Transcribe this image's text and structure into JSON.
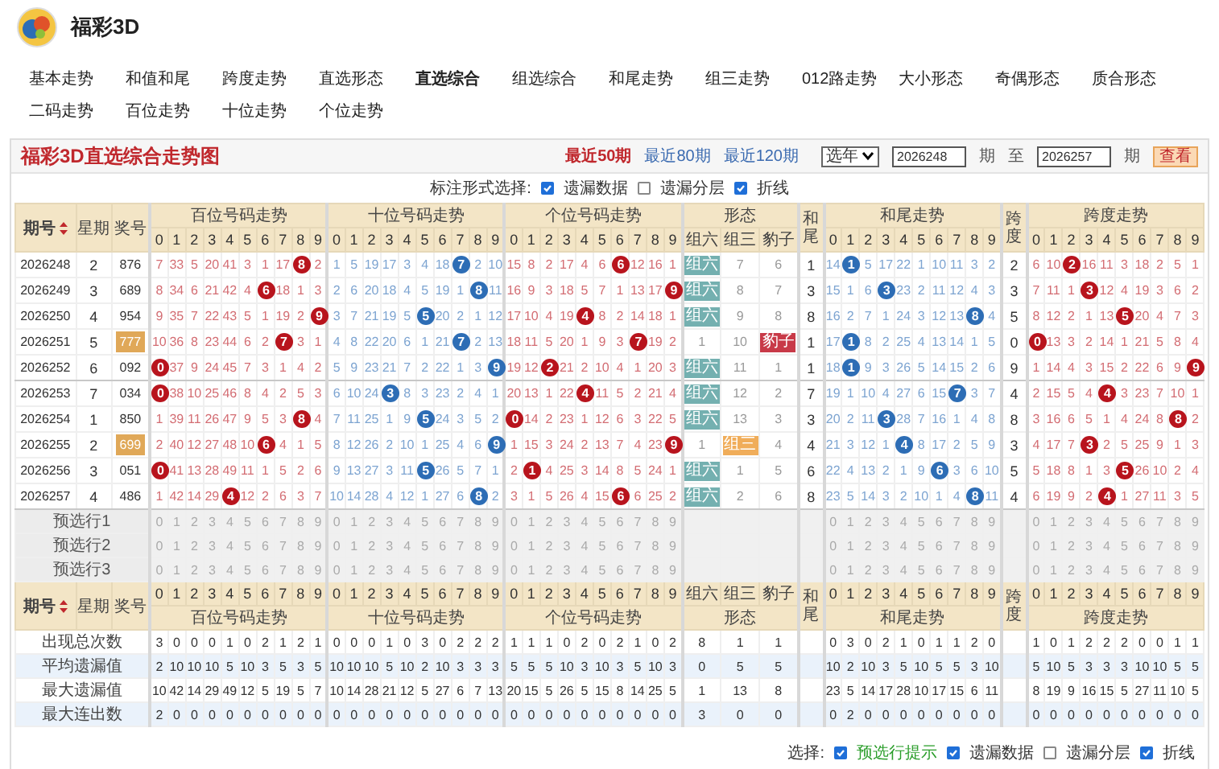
{
  "app": {
    "title": "福彩3D"
  },
  "nav": [
    {
      "label": "基本走势",
      "selected": false
    },
    {
      "label": "和值和尾",
      "selected": false
    },
    {
      "label": "跨度走势",
      "selected": false
    },
    {
      "label": "直选形态",
      "selected": false
    },
    {
      "label": "直选综合",
      "selected": true
    },
    {
      "label": "组选综合",
      "selected": false
    },
    {
      "label": "和尾走势",
      "selected": false
    },
    {
      "label": "组三走势",
      "selected": false
    },
    {
      "label": "012路走势",
      "selected": false
    },
    {
      "label": "大小形态",
      "selected": false
    },
    {
      "label": "奇偶形态",
      "selected": false
    },
    {
      "label": "质合形态",
      "selected": false
    },
    {
      "label": "二码走势",
      "selected": false
    },
    {
      "label": "百位走势",
      "selected": false
    },
    {
      "label": "十位走势",
      "selected": false
    },
    {
      "label": "个位走势",
      "selected": false
    }
  ],
  "panel": {
    "title": "福彩3D直选综合走势图",
    "range_links": [
      {
        "label": "最近50期",
        "selected": true
      },
      {
        "label": "最近80期",
        "selected": false
      },
      {
        "label": "最近120期",
        "selected": false
      }
    ],
    "year_select": "选年",
    "from": "2026248",
    "from_unit": "期",
    "to_label": "至",
    "to": "2026257",
    "to_unit": "期",
    "query_button": "查看"
  },
  "mark_options": {
    "label": "标注形式选择:",
    "options": [
      {
        "label": "遗漏数据",
        "checked": true
      },
      {
        "label": "遗漏分层",
        "checked": false
      },
      {
        "label": "折线",
        "checked": true
      }
    ]
  },
  "table": {
    "head": {
      "period": "期号",
      "weekday": "星期",
      "number": "奖号"
    },
    "sections": [
      {
        "kind": "digits",
        "title": "百位号码走势",
        "color": "#b8141d",
        "digits": [
          "0",
          "1",
          "2",
          "3",
          "4",
          "5",
          "6",
          "7",
          "8",
          "9"
        ]
      },
      {
        "kind": "digits",
        "title": "十位号码走势",
        "color": "#2d6db5",
        "digits": [
          "0",
          "1",
          "2",
          "3",
          "4",
          "5",
          "6",
          "7",
          "8",
          "9"
        ]
      },
      {
        "kind": "digits",
        "title": "个位号码走势",
        "color": "#b8141d",
        "digits": [
          "0",
          "1",
          "2",
          "3",
          "4",
          "5",
          "6",
          "7",
          "8",
          "9"
        ]
      },
      {
        "kind": "shape",
        "title": "形态",
        "columns": [
          {
            "label": "组六",
            "color": "#74b0b0"
          },
          {
            "label": "组三",
            "color": "#f0ad5a"
          },
          {
            "label": "豹子",
            "color": "#c83a48"
          }
        ]
      },
      {
        "kind": "single",
        "title": "和尾"
      },
      {
        "kind": "digits",
        "title": "和尾走势",
        "color": "#2d6db5",
        "digits": [
          "0",
          "1",
          "2",
          "3",
          "4",
          "5",
          "6",
          "7",
          "8",
          "9"
        ]
      },
      {
        "kind": "single",
        "title": "跨度"
      },
      {
        "kind": "digits",
        "title": "跨度走势",
        "color": "#b8141d",
        "digits": [
          "0",
          "1",
          "2",
          "3",
          "4",
          "5",
          "6",
          "7",
          "8",
          "9"
        ]
      }
    ],
    "rows": [
      {
        "period": "2026248",
        "weekday": "2",
        "number": "876",
        "highlighted": false,
        "cells": [
          [
            "7",
            "33",
            "5",
            "20",
            "41",
            "3",
            "1",
            "17",
            {
              "text": "8",
              "hit": true
            },
            "2"
          ],
          [
            "1",
            "5",
            "19",
            "17",
            "3",
            "4",
            "18",
            {
              "text": "7",
              "hit": true
            },
            "2",
            "10"
          ],
          [
            "15",
            "8",
            "2",
            "17",
            "4",
            "6",
            {
              "text": "6",
              "hit": true
            },
            "12",
            "16",
            "1"
          ],
          [
            {
              "text": "组六",
              "hit": true
            },
            "7",
            "6"
          ],
          [
            "1"
          ],
          [
            "14",
            {
              "text": "1",
              "hit": true
            },
            "5",
            "17",
            "22",
            "1",
            "10",
            "11",
            "3",
            "2"
          ],
          [
            "2"
          ],
          [
            "6",
            "10",
            {
              "text": "2",
              "hit": true
            },
            "16",
            "11",
            "3",
            "18",
            "2",
            "5",
            "1"
          ]
        ]
      },
      {
        "period": "2026249",
        "weekday": "3",
        "number": "689",
        "highlighted": false,
        "cells": [
          [
            "8",
            "34",
            "6",
            "21",
            "42",
            "4",
            {
              "text": "6",
              "hit": true
            },
            "18",
            "1",
            "3"
          ],
          [
            "2",
            "6",
            "20",
            "18",
            "4",
            "5",
            "19",
            "1",
            {
              "text": "8",
              "hit": true
            },
            "11"
          ],
          [
            "16",
            "9",
            "3",
            "18",
            "5",
            "7",
            "1",
            "13",
            "17",
            {
              "text": "9",
              "hit": true
            }
          ],
          [
            {
              "text": "组六",
              "hit": true
            },
            "8",
            "7"
          ],
          [
            "3"
          ],
          [
            "15",
            "1",
            "6",
            {
              "text": "3",
              "hit": true
            },
            "23",
            "2",
            "11",
            "12",
            "4",
            "3"
          ],
          [
            "3"
          ],
          [
            "7",
            "11",
            "1",
            {
              "text": "3",
              "hit": true
            },
            "12",
            "4",
            "19",
            "3",
            "6",
            "2"
          ]
        ]
      },
      {
        "period": "2026250",
        "weekday": "4",
        "number": "954",
        "highlighted": false,
        "cells": [
          [
            "9",
            "35",
            "7",
            "22",
            "43",
            "5",
            "1",
            "19",
            "2",
            {
              "text": "9",
              "hit": true
            }
          ],
          [
            "3",
            "7",
            "21",
            "19",
            "5",
            {
              "text": "5",
              "hit": true
            },
            "20",
            "2",
            "1",
            "12"
          ],
          [
            "17",
            "10",
            "4",
            "19",
            {
              "text": "4",
              "hit": true
            },
            "8",
            "2",
            "14",
            "18",
            "1"
          ],
          [
            {
              "text": "组六",
              "hit": true
            },
            "9",
            "8"
          ],
          [
            "8"
          ],
          [
            "16",
            "2",
            "7",
            "1",
            "24",
            "3",
            "12",
            "13",
            {
              "text": "8",
              "hit": true
            },
            "4"
          ],
          [
            "5"
          ],
          [
            "8",
            "12",
            "2",
            "1",
            "13",
            {
              "text": "5",
              "hit": true
            },
            "20",
            "4",
            "7",
            "3"
          ]
        ]
      },
      {
        "period": "2026251",
        "weekday": "5",
        "number": "777",
        "highlighted": true,
        "cells": [
          [
            "10",
            "36",
            "8",
            "23",
            "44",
            "6",
            "2",
            {
              "text": "7",
              "hit": true
            },
            "3",
            "1"
          ],
          [
            "4",
            "8",
            "22",
            "20",
            "6",
            "1",
            "21",
            {
              "text": "7",
              "hit": true
            },
            "2",
            "13"
          ],
          [
            "18",
            "11",
            "5",
            "20",
            "1",
            "9",
            "3",
            {
              "text": "7",
              "hit": true
            },
            "19",
            "2"
          ],
          [
            "1",
            "10",
            {
              "text": "豹子",
              "hit": true
            }
          ],
          [
            "1"
          ],
          [
            "17",
            {
              "text": "1",
              "hit": true
            },
            "8",
            "2",
            "25",
            "4",
            "13",
            "14",
            "1",
            "5"
          ],
          [
            "0"
          ],
          [
            {
              "text": "0",
              "hit": true
            },
            "13",
            "3",
            "2",
            "14",
            "1",
            "21",
            "5",
            "8",
            "4"
          ]
        ]
      },
      {
        "period": "2026252",
        "weekday": "6",
        "number": "092",
        "highlighted": false,
        "cells": [
          [
            {
              "text": "0",
              "hit": true
            },
            "37",
            "9",
            "24",
            "45",
            "7",
            "3",
            "1",
            "4",
            "2"
          ],
          [
            "5",
            "9",
            "23",
            "21",
            "7",
            "2",
            "22",
            "1",
            "3",
            {
              "text": "9",
              "hit": true
            }
          ],
          [
            "19",
            "12",
            {
              "text": "2",
              "hit": true
            },
            "21",
            "2",
            "10",
            "4",
            "1",
            "20",
            "3"
          ],
          [
            {
              "text": "组六",
              "hit": true
            },
            "11",
            "1"
          ],
          [
            "1"
          ],
          [
            "18",
            {
              "text": "1",
              "hit": true
            },
            "9",
            "3",
            "26",
            "5",
            "14",
            "15",
            "2",
            "6"
          ],
          [
            "9"
          ],
          [
            "1",
            "14",
            "4",
            "3",
            "15",
            "2",
            "22",
            "6",
            "9",
            {
              "text": "9",
              "hit": true
            }
          ]
        ]
      },
      {
        "period": "2026253",
        "weekday": "7",
        "number": "034",
        "highlighted": false,
        "cells": [
          [
            {
              "text": "0",
              "hit": true
            },
            "38",
            "10",
            "25",
            "46",
            "8",
            "4",
            "2",
            "5",
            "3"
          ],
          [
            "6",
            "10",
            "24",
            {
              "text": "3",
              "hit": true
            },
            "8",
            "3",
            "23",
            "2",
            "4",
            "1"
          ],
          [
            "20",
            "13",
            "1",
            "22",
            {
              "text": "4",
              "hit": true
            },
            "11",
            "5",
            "2",
            "21",
            "4"
          ],
          [
            {
              "text": "组六",
              "hit": true
            },
            "12",
            "2"
          ],
          [
            "7"
          ],
          [
            "19",
            "1",
            "10",
            "4",
            "27",
            "6",
            "15",
            {
              "text": "7",
              "hit": true
            },
            "3",
            "7"
          ],
          [
            "4"
          ],
          [
            "2",
            "15",
            "5",
            "4",
            {
              "text": "4",
              "hit": true
            },
            "3",
            "23",
            "7",
            "10",
            "1"
          ]
        ]
      },
      {
        "period": "2026254",
        "weekday": "1",
        "number": "850",
        "highlighted": false,
        "cells": [
          [
            "1",
            "39",
            "11",
            "26",
            "47",
            "9",
            "5",
            "3",
            {
              "text": "8",
              "hit": true
            },
            "4"
          ],
          [
            "7",
            "11",
            "25",
            "1",
            "9",
            {
              "text": "5",
              "hit": true
            },
            "24",
            "3",
            "5",
            "2"
          ],
          [
            {
              "text": "0",
              "hit": true
            },
            "14",
            "2",
            "23",
            "1",
            "12",
            "6",
            "3",
            "22",
            "5"
          ],
          [
            {
              "text": "组六",
              "hit": true
            },
            "13",
            "3"
          ],
          [
            "3"
          ],
          [
            "20",
            "2",
            "11",
            {
              "text": "3",
              "hit": true
            },
            "28",
            "7",
            "16",
            "1",
            "4",
            "8"
          ],
          [
            "8"
          ],
          [
            "3",
            "16",
            "6",
            "5",
            "1",
            "4",
            "24",
            "8",
            {
              "text": "8",
              "hit": true
            },
            "2"
          ]
        ]
      },
      {
        "period": "2026255",
        "weekday": "2",
        "number": "699",
        "highlighted": true,
        "cells": [
          [
            "2",
            "40",
            "12",
            "27",
            "48",
            "10",
            {
              "text": "6",
              "hit": true
            },
            "4",
            "1",
            "5"
          ],
          [
            "8",
            "12",
            "26",
            "2",
            "10",
            "1",
            "25",
            "4",
            "6",
            {
              "text": "9",
              "hit": true
            }
          ],
          [
            "1",
            "15",
            "3",
            "24",
            "2",
            "13",
            "7",
            "4",
            "23",
            {
              "text": "9",
              "hit": true
            }
          ],
          [
            "1",
            {
              "text": "组三",
              "hit": true
            },
            "4"
          ],
          [
            "4"
          ],
          [
            "21",
            "3",
            "12",
            "1",
            {
              "text": "4",
              "hit": true
            },
            "8",
            "17",
            "2",
            "5",
            "9"
          ],
          [
            "3"
          ],
          [
            "4",
            "17",
            "7",
            {
              "text": "3",
              "hit": true
            },
            "2",
            "5",
            "25",
            "9",
            "1",
            "3"
          ]
        ]
      },
      {
        "period": "2026256",
        "weekday": "3",
        "number": "051",
        "highlighted": false,
        "cells": [
          [
            {
              "text": "0",
              "hit": true
            },
            "41",
            "13",
            "28",
            "49",
            "11",
            "1",
            "5",
            "2",
            "6"
          ],
          [
            "9",
            "13",
            "27",
            "3",
            "11",
            {
              "text": "5",
              "hit": true
            },
            "26",
            "5",
            "7",
            "1"
          ],
          [
            "2",
            {
              "text": "1",
              "hit": true
            },
            "4",
            "25",
            "3",
            "14",
            "8",
            "5",
            "24",
            "1"
          ],
          [
            {
              "text": "组六",
              "hit": true
            },
            "1",
            "5"
          ],
          [
            "6"
          ],
          [
            "22",
            "4",
            "13",
            "2",
            "1",
            "9",
            {
              "text": "6",
              "hit": true
            },
            "3",
            "6",
            "10"
          ],
          [
            "5"
          ],
          [
            "5",
            "18",
            "8",
            "1",
            "3",
            {
              "text": "5",
              "hit": true
            },
            "26",
            "10",
            "2",
            "4"
          ]
        ]
      },
      {
        "period": "2026257",
        "weekday": "4",
        "number": "486",
        "highlighted": false,
        "cells": [
          [
            "1",
            "42",
            "14",
            "29",
            {
              "text": "4",
              "hit": true
            },
            "12",
            "2",
            "6",
            "3",
            "7"
          ],
          [
            "10",
            "14",
            "28",
            "4",
            "12",
            "1",
            "27",
            "6",
            {
              "text": "8",
              "hit": true
            },
            "2"
          ],
          [
            "3",
            "1",
            "5",
            "26",
            "4",
            "15",
            {
              "text": "6",
              "hit": true
            },
            "6",
            "25",
            "2"
          ],
          [
            {
              "text": "组六",
              "hit": true
            },
            "2",
            "6"
          ],
          [
            "8"
          ],
          [
            "23",
            "5",
            "14",
            "3",
            "2",
            "10",
            "1",
            "4",
            {
              "text": "8",
              "hit": true
            },
            "11"
          ],
          [
            "4"
          ],
          [
            "6",
            "19",
            "9",
            "2",
            {
              "text": "4",
              "hit": true
            },
            "1",
            "27",
            "11",
            "3",
            "5"
          ]
        ]
      }
    ],
    "preselect_rows": [
      {
        "label": "预选行1",
        "cells": [
          [
            "0",
            "1",
            "2",
            "3",
            "4",
            "5",
            "6",
            "7",
            "8",
            "9"
          ],
          [
            "0",
            "1",
            "2",
            "3",
            "4",
            "5",
            "6",
            "7",
            "8",
            "9"
          ],
          [
            "0",
            "1",
            "2",
            "3",
            "4",
            "5",
            "6",
            "7",
            "8",
            "9"
          ],
          null,
          null,
          [
            "0",
            "1",
            "2",
            "3",
            "4",
            "5",
            "6",
            "7",
            "8",
            "9"
          ],
          null,
          [
            "0",
            "1",
            "2",
            "3",
            "4",
            "5",
            "6",
            "7",
            "8",
            "9"
          ]
        ]
      },
      {
        "label": "预选行2",
        "cells": [
          [
            "0",
            "1",
            "2",
            "3",
            "4",
            "5",
            "6",
            "7",
            "8",
            "9"
          ],
          [
            "0",
            "1",
            "2",
            "3",
            "4",
            "5",
            "6",
            "7",
            "8",
            "9"
          ],
          [
            "0",
            "1",
            "2",
            "3",
            "4",
            "5",
            "6",
            "7",
            "8",
            "9"
          ],
          null,
          null,
          [
            "0",
            "1",
            "2",
            "3",
            "4",
            "5",
            "6",
            "7",
            "8",
            "9"
          ],
          null,
          [
            "0",
            "1",
            "2",
            "3",
            "4",
            "5",
            "6",
            "7",
            "8",
            "9"
          ]
        ]
      },
      {
        "label": "预选行3",
        "cells": [
          [
            "0",
            "1",
            "2",
            "3",
            "4",
            "5",
            "6",
            "7",
            "8",
            "9"
          ],
          [
            "0",
            "1",
            "2",
            "3",
            "4",
            "5",
            "6",
            "7",
            "8",
            "9"
          ],
          [
            "0",
            "1",
            "2",
            "3",
            "4",
            "5",
            "6",
            "7",
            "8",
            "9"
          ],
          null,
          null,
          [
            "0",
            "1",
            "2",
            "3",
            "4",
            "5",
            "6",
            "7",
            "8",
            "9"
          ],
          null,
          [
            "0",
            "1",
            "2",
            "3",
            "4",
            "5",
            "6",
            "7",
            "8",
            "9"
          ]
        ]
      }
    ],
    "foot_head": {
      "period": "期号",
      "weekday": "星期",
      "number": "奖号",
      "sections": [
        {
          "title": "百位号码走势",
          "digits": [
            "0",
            "1",
            "2",
            "3",
            "4",
            "5",
            "6",
            "7",
            "8",
            "9"
          ]
        },
        {
          "title": "十位号码走势",
          "digits": [
            "0",
            "1",
            "2",
            "3",
            "4",
            "5",
            "6",
            "7",
            "8",
            "9"
          ]
        },
        {
          "title": "个位号码走势",
          "digits": [
            "0",
            "1",
            "2",
            "3",
            "4",
            "5",
            "6",
            "7",
            "8",
            "9"
          ]
        },
        {
          "title": "形态",
          "columns": [
            "组六",
            "组三",
            "豹子"
          ]
        },
        {
          "title": "和尾"
        },
        {
          "title": "和尾走势",
          "digits": [
            "0",
            "1",
            "2",
            "3",
            "4",
            "5",
            "6",
            "7",
            "8",
            "9"
          ]
        },
        {
          "title": "跨度"
        },
        {
          "title": "跨度走势",
          "digits": [
            "0",
            "1",
            "2",
            "3",
            "4",
            "5",
            "6",
            "7",
            "8",
            "9"
          ]
        }
      ]
    },
    "stats_rows": [
      {
        "label": "出现总次数",
        "cells": [
          [
            "3",
            "0",
            "0",
            "0",
            "1",
            "0",
            "2",
            "1",
            "2",
            "1"
          ],
          [
            "0",
            "0",
            "0",
            "1",
            "0",
            "3",
            "0",
            "2",
            "2",
            "2"
          ],
          [
            "1",
            "1",
            "1",
            "0",
            "2",
            "0",
            "2",
            "1",
            "0",
            "2"
          ],
          [
            "8",
            "1",
            "1"
          ],
          null,
          [
            "0",
            "3",
            "0",
            "2",
            "1",
            "0",
            "1",
            "1",
            "2",
            "0"
          ],
          null,
          [
            "1",
            "0",
            "1",
            "2",
            "2",
            "2",
            "0",
            "0",
            "1",
            "1"
          ]
        ]
      },
      {
        "label": "平均遗漏值",
        "cells": [
          [
            "2",
            "10",
            "10",
            "10",
            "5",
            "10",
            "3",
            "5",
            "3",
            "5"
          ],
          [
            "10",
            "10",
            "10",
            "5",
            "10",
            "2",
            "10",
            "3",
            "3",
            "3"
          ],
          [
            "5",
            "5",
            "5",
            "10",
            "3",
            "10",
            "3",
            "5",
            "10",
            "3"
          ],
          [
            "0",
            "5",
            "5"
          ],
          null,
          [
            "10",
            "2",
            "10",
            "3",
            "5",
            "10",
            "5",
            "5",
            "3",
            "10"
          ],
          null,
          [
            "5",
            "10",
            "5",
            "3",
            "3",
            "3",
            "10",
            "10",
            "5",
            "5"
          ]
        ]
      },
      {
        "label": "最大遗漏值",
        "cells": [
          [
            "10",
            "42",
            "14",
            "29",
            "49",
            "12",
            "5",
            "19",
            "5",
            "7"
          ],
          [
            "10",
            "14",
            "28",
            "21",
            "12",
            "5",
            "27",
            "6",
            "7",
            "13"
          ],
          [
            "20",
            "15",
            "5",
            "26",
            "5",
            "15",
            "8",
            "14",
            "25",
            "5"
          ],
          [
            "1",
            "13",
            "8"
          ],
          null,
          [
            "23",
            "5",
            "14",
            "17",
            "28",
            "10",
            "17",
            "15",
            "6",
            "11"
          ],
          null,
          [
            "8",
            "19",
            "9",
            "16",
            "15",
            "5",
            "27",
            "11",
            "10",
            "5"
          ]
        ]
      },
      {
        "label": "最大连出数",
        "cells": [
          [
            "2",
            "0",
            "0",
            "0",
            "0",
            "0",
            "0",
            "0",
            "0",
            "0"
          ],
          [
            "0",
            "0",
            "0",
            "0",
            "0",
            "0",
            "0",
            "0",
            "0",
            "0"
          ],
          [
            "0",
            "0",
            "0",
            "0",
            "0",
            "0",
            "0",
            "0",
            "0",
            "0"
          ],
          [
            "3",
            "0",
            "0"
          ],
          null,
          [
            "0",
            "2",
            "0",
            "0",
            "0",
            "0",
            "0",
            "0",
            "0",
            "0"
          ],
          null,
          [
            "0",
            "0",
            "0",
            "0",
            "0",
            "0",
            "0",
            "0",
            "0",
            "0"
          ]
        ]
      }
    ]
  },
  "bottom_options": {
    "label": "选择:",
    "options": [
      {
        "label": "预选行提示",
        "checked": true,
        "kind": "accent"
      },
      {
        "label": "遗漏数据",
        "checked": true,
        "kind": "plain"
      },
      {
        "label": "遗漏分层",
        "checked": false,
        "kind": "plain"
      },
      {
        "label": "折线",
        "checked": true,
        "kind": "plain"
      }
    ]
  }
}
